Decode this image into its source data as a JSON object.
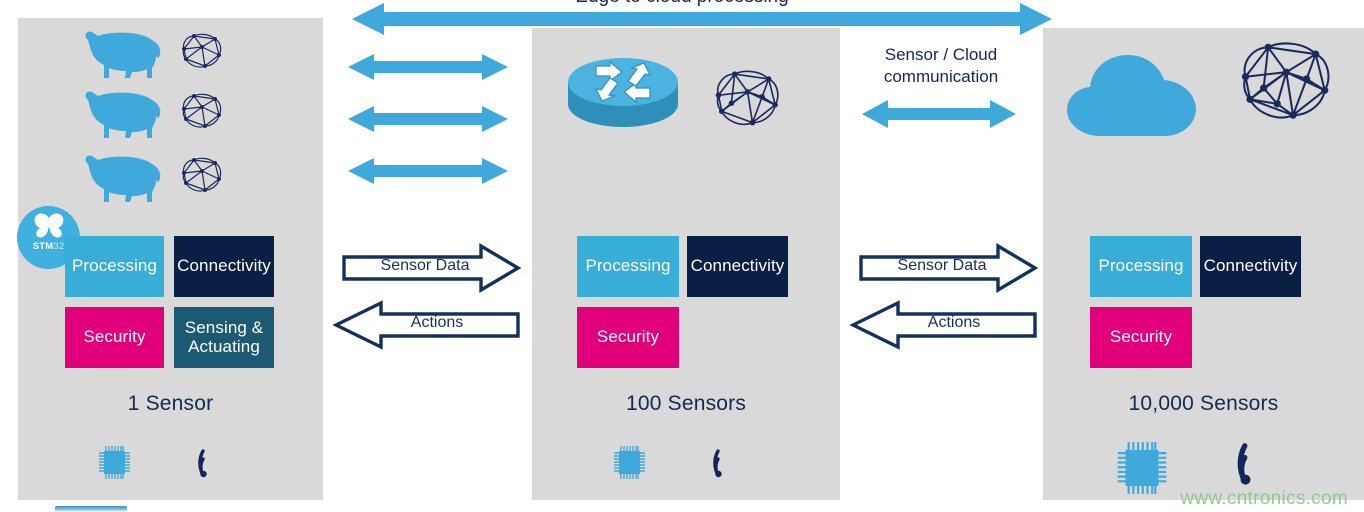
{
  "diagram": {
    "top_banner_text": "Edge to cloud processing",
    "watermark": "www.cntronics.com",
    "colors": {
      "panel_bg": "#d9d9d9",
      "processing": "#38add8",
      "connectivity": "#0a1f44",
      "security": "#e2007a",
      "sensing": "#1b5a72",
      "arrow_blue": "#3fa9dc",
      "navy_text": "#13265a"
    }
  },
  "panels": {
    "edge": {
      "count_label": "1 Sensor",
      "boxes": {
        "processing": "Processing",
        "connectivity": "Connectivity",
        "security": "Security",
        "sensing": "Sensing & Actuating"
      },
      "badge": {
        "brand_strong": "STM",
        "brand_light": "32"
      }
    },
    "gateway": {
      "count_label": "100 Sensors",
      "boxes": {
        "processing": "Processing",
        "connectivity": "Connectivity",
        "security": "Security"
      }
    },
    "cloud": {
      "count_label": "10,000 Sensors",
      "boxes": {
        "processing": "Processing",
        "connectivity": "Connectivity",
        "security": "Security"
      }
    }
  },
  "links": {
    "edge_to_gateway": {
      "sensor_data": "Sensor Data",
      "actions": "Actions"
    },
    "gateway_to_cloud": {
      "caption_line1": "Sensor / Cloud",
      "caption_line2": "communication",
      "sensor_data": "Sensor Data",
      "actions": "Actions"
    }
  }
}
